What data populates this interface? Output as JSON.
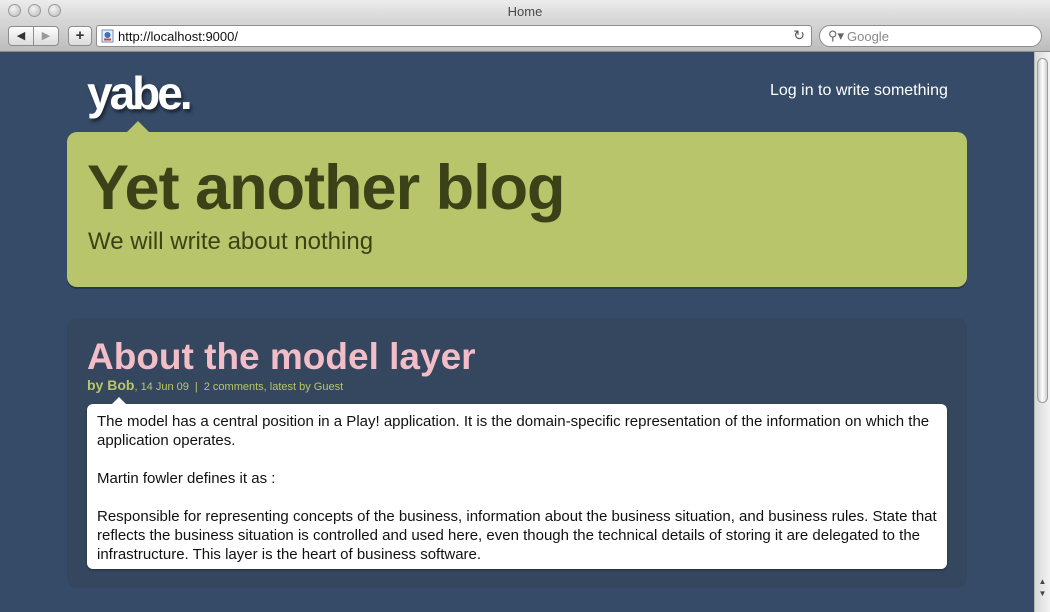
{
  "window": {
    "title": "Home"
  },
  "toolbar": {
    "back_icon": "back-arrow",
    "forward_icon": "forward-arrow",
    "add_label": "+",
    "url": "http://localhost:9000/",
    "search_placeholder": "Google"
  },
  "site": {
    "logo": "yabe.",
    "login_link": "Log in to write something",
    "blog_title": "Yet another blog",
    "blog_description": "We will write about nothing"
  },
  "post": {
    "title": "About the model layer",
    "author": "by Bob",
    "date": ", 14 Jun 09",
    "separator": "|",
    "comments": "2 comments",
    "latest": ", latest by Guest",
    "paragraphs": [
      "The model has a central position in a Play! application. It is the domain-specific representation of the information on which the application operates.",
      "Martin fowler defines it as :",
      "Responsible for representing concepts of the business, information about the business situation, and business rules. State that reflects the business situation is controlled and used here, even though the technical details of storing it are delegated to the infrastructure. This layer is the heart of business software."
    ]
  },
  "colors": {
    "page_background": "#364b68",
    "header_background": "#b8c56a",
    "title_pink": "#f3bdc8",
    "meta_green": "#b8c56a"
  }
}
